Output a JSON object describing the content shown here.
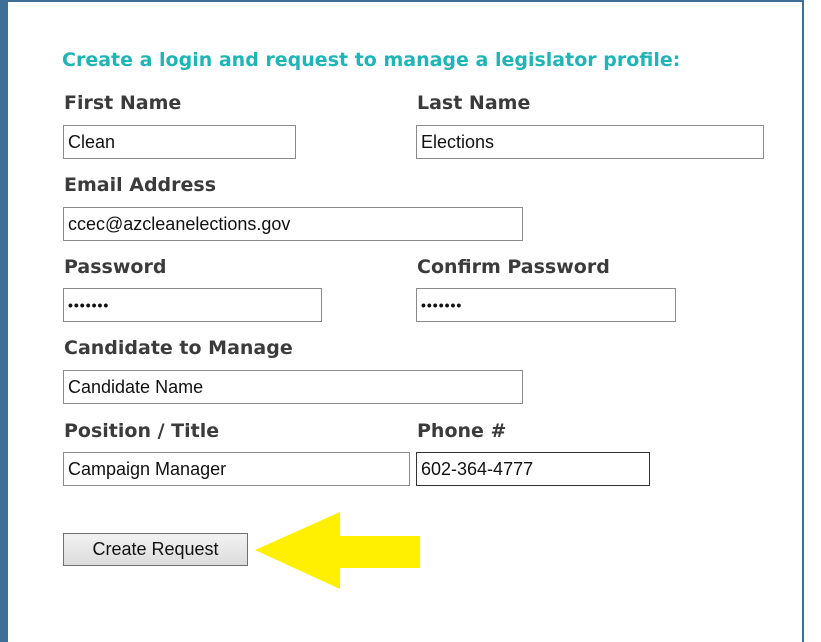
{
  "form": {
    "heading": "Create a login and request to manage a legislator profile:",
    "first_name": {
      "label": "First Name",
      "value": "Clean"
    },
    "last_name": {
      "label": "Last Name",
      "value": "Elections"
    },
    "email": {
      "label": "Email Address",
      "value": "ccec@azcleanelections.gov"
    },
    "password": {
      "label": "Password",
      "value": "•••••••"
    },
    "confirm_password": {
      "label": "Confirm Password",
      "value": "•••••••"
    },
    "candidate": {
      "label": "Candidate to Manage",
      "value": "Candidate Name"
    },
    "position": {
      "label": "Position / Title",
      "value": "Campaign Manager"
    },
    "phone": {
      "label": "Phone #",
      "value": "602-364-4777"
    },
    "submit_label": "Create Request"
  },
  "colors": {
    "heading": "#1fb5b7",
    "border": "#3d6f97",
    "arrow": "#ffef00"
  },
  "icons": {
    "arrow": "arrow-left-icon"
  }
}
